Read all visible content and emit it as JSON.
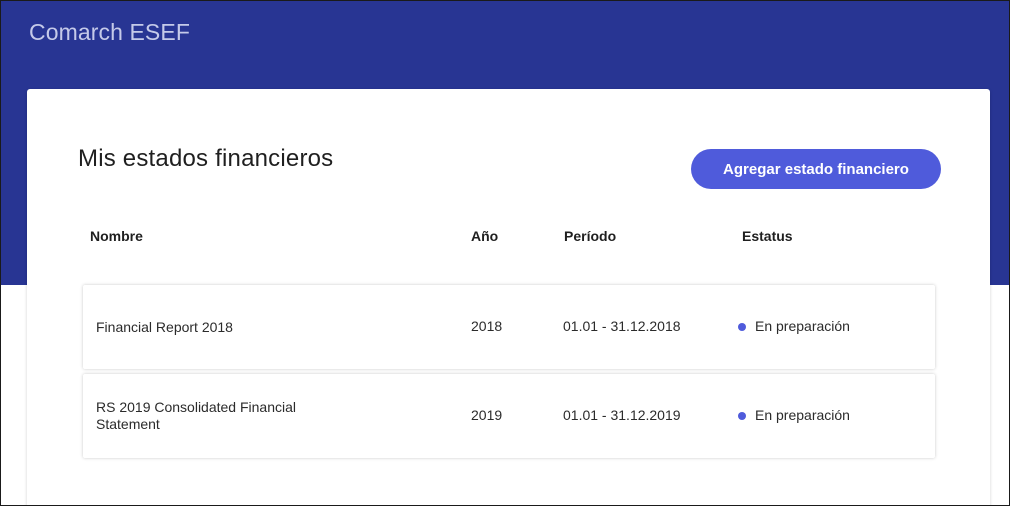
{
  "app": {
    "title": "Comarch ESEF"
  },
  "page": {
    "title": "Mis estados financieros",
    "add_button_label": "Agregar estado financiero"
  },
  "table": {
    "columns": {
      "name": "Nombre",
      "year": "Año",
      "period": "Período",
      "status": "Estatus"
    },
    "rows": [
      {
        "name": "Financial Report 2018",
        "year": "2018",
        "period": "01.01 - 31.12.2018",
        "status": "En preparación"
      },
      {
        "name": "RS 2019 Consolidated Financial Statement",
        "year": "2019",
        "period": "01.01 - 31.12.2019",
        "status": "En preparación"
      }
    ]
  },
  "colors": {
    "header_bg": "#283593",
    "accent": "#4f5bdb",
    "status_dot": "#4f5bdb"
  }
}
